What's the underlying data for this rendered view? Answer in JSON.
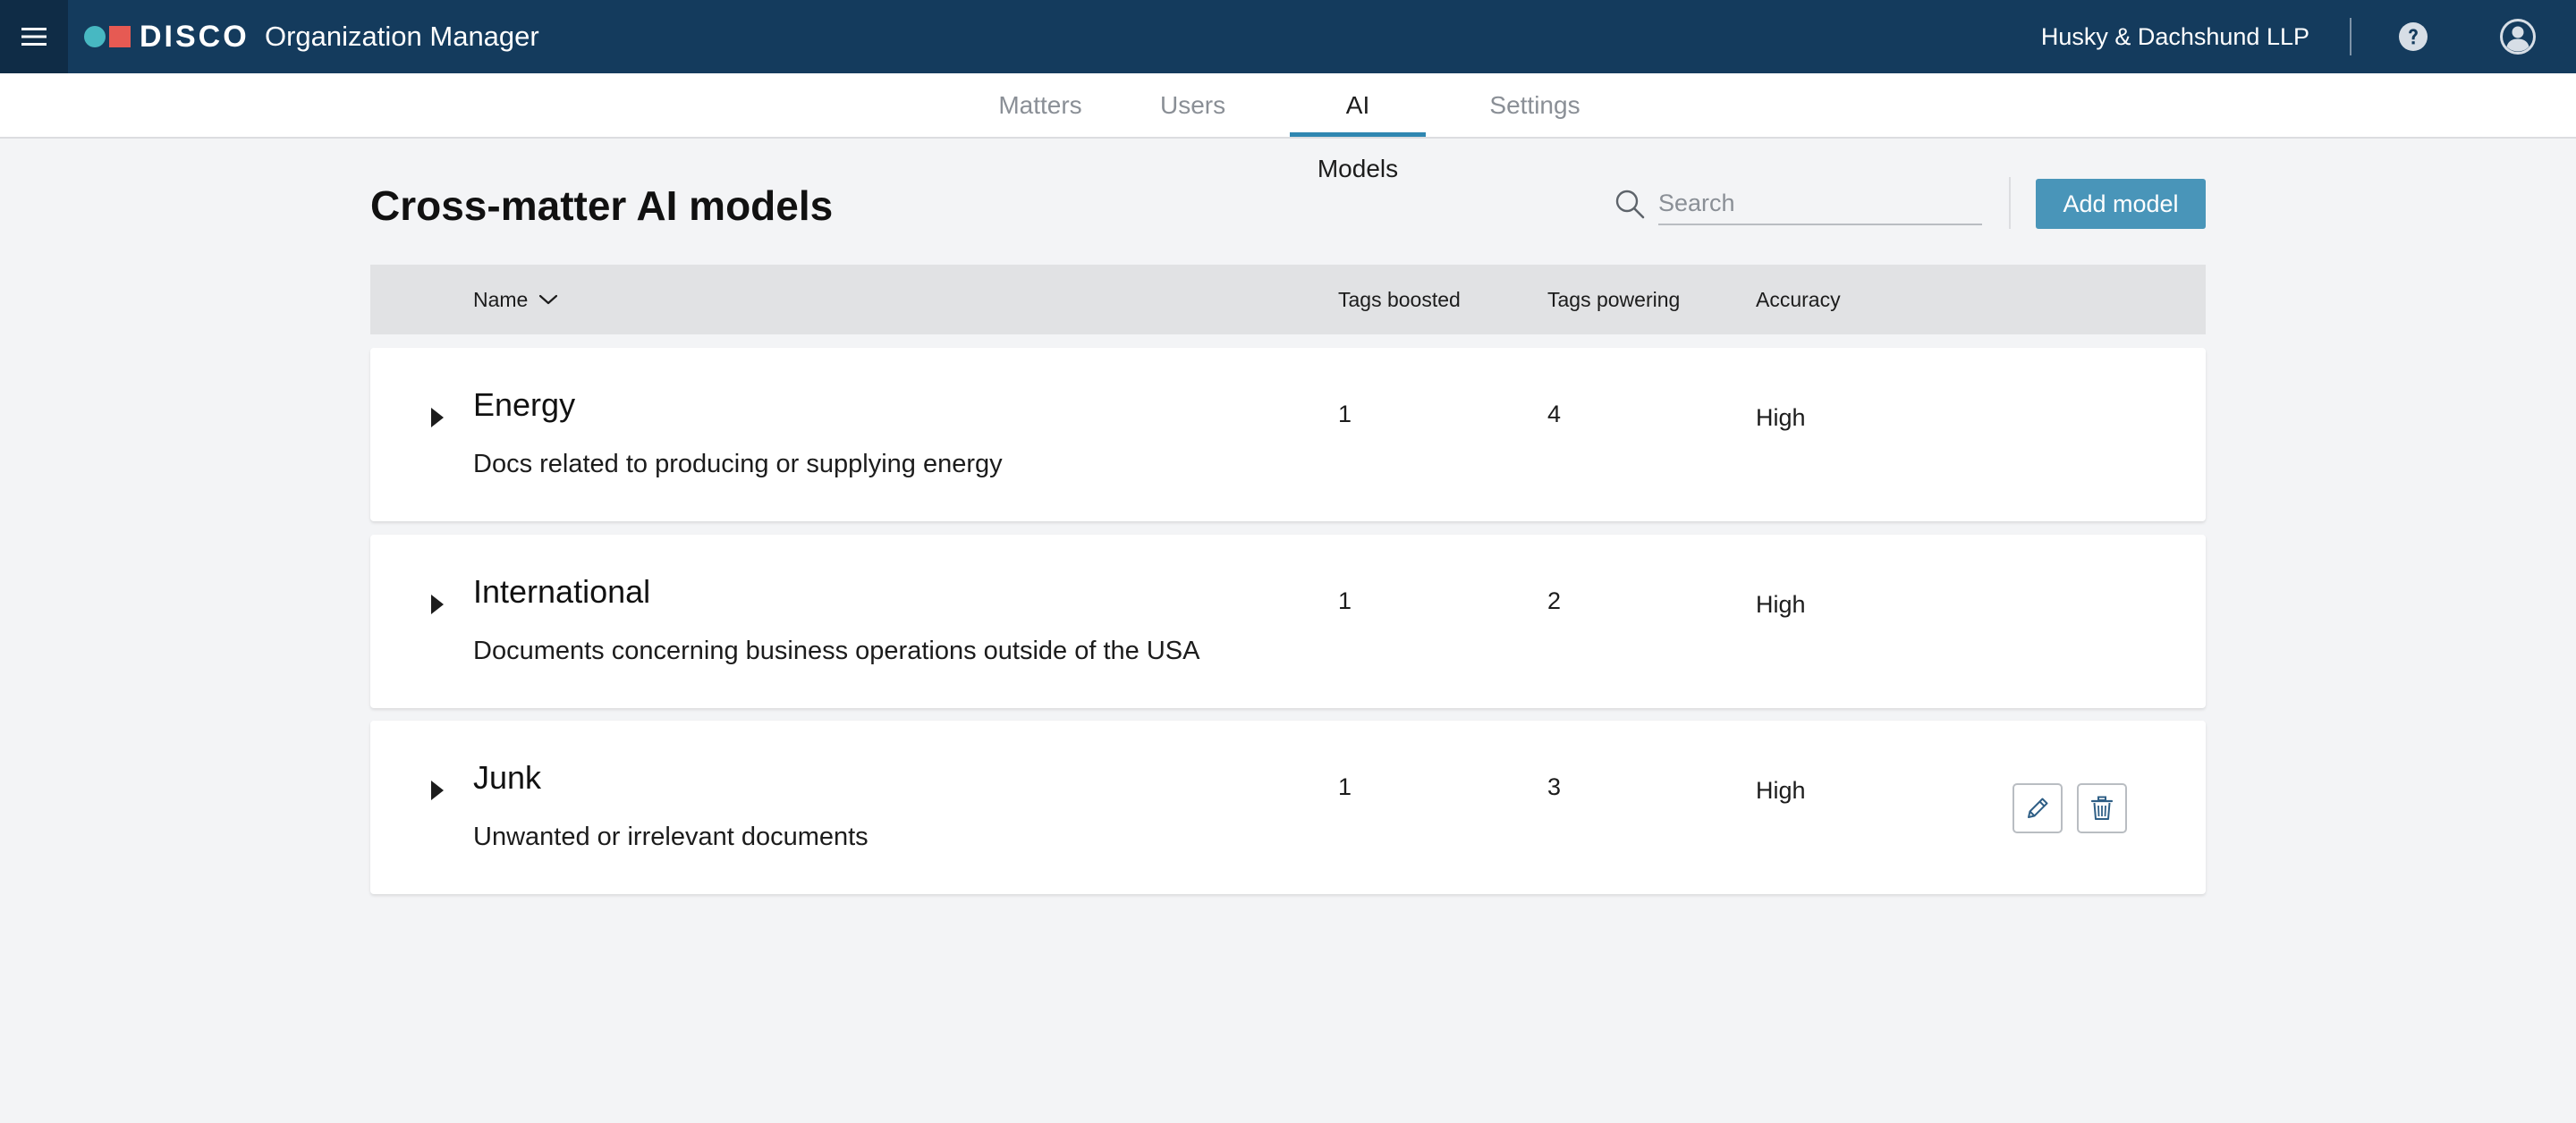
{
  "app": {
    "logo_text": "DISCO",
    "title": "Organization Manager",
    "organization": "Husky & Dachshund LLP"
  },
  "icons": {
    "menu": "hamburger-menu-icon",
    "help": "help-circle-icon",
    "user": "user-avatar-icon",
    "search": "search-icon",
    "expand": "caret-right-icon",
    "sort": "chevron-down-icon",
    "edit": "pencil-icon",
    "delete": "trash-icon"
  },
  "colors": {
    "topbar": "#143b5d",
    "accent": "#2f87b1",
    "primary_button": "#4995b9",
    "logo_dot": "#47b8c2",
    "logo_square": "#e65a53"
  },
  "tabs": [
    {
      "label": "Matters",
      "active": false
    },
    {
      "label": "Users",
      "active": false
    },
    {
      "label": "AI Models",
      "active": true
    },
    {
      "label": "Settings",
      "active": false
    }
  ],
  "page": {
    "title": "Cross-matter AI models",
    "search_placeholder": "Search",
    "search_value": "",
    "add_button": "Add model"
  },
  "table": {
    "columns": {
      "name": "Name",
      "tags_boosted": "Tags boosted",
      "tags_powering": "Tags powering",
      "accuracy": "Accuracy"
    },
    "sort": {
      "column": "name",
      "direction": "descending-indicator"
    },
    "rows": [
      {
        "name": "Energy",
        "description": "Docs related to producing or supplying energy",
        "tags_boosted": "1",
        "tags_powering": "4",
        "accuracy": "High",
        "actions_visible": false
      },
      {
        "name": "International",
        "description": "Documents concerning business operations outside of the USA",
        "tags_boosted": "1",
        "tags_powering": "2",
        "accuracy": "High",
        "actions_visible": false
      },
      {
        "name": "Junk",
        "description": "Unwanted or irrelevant documents",
        "tags_boosted": "1",
        "tags_powering": "3",
        "accuracy": "High",
        "actions_visible": true
      }
    ]
  }
}
